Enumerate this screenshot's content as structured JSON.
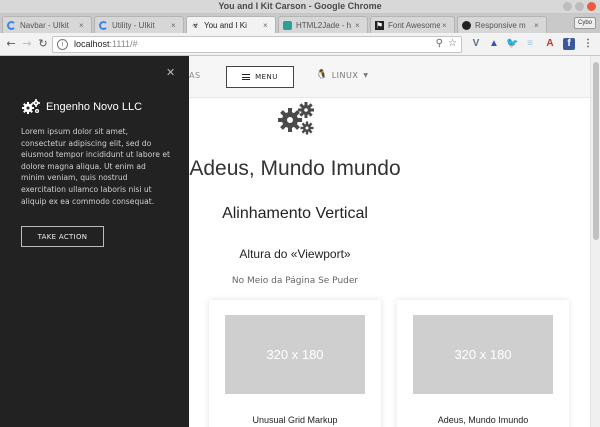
{
  "window": {
    "title": "You and I Kit Carson - Google Chrome"
  },
  "tabs": [
    {
      "label": "Navbar - UIkit",
      "favicon": "spinner-icon"
    },
    {
      "label": "Utility - UIkit",
      "favicon": "spinner-icon"
    },
    {
      "label": "You and I Ki",
      "favicon": "biohazard-icon",
      "active": true
    },
    {
      "label": "HTML2Jade - h",
      "favicon": "html-icon"
    },
    {
      "label": "Font Awesome",
      "favicon": "flag-icon"
    },
    {
      "label": "Responsive m",
      "favicon": "github-icon"
    }
  ],
  "profile_badge": "Cybo",
  "address_bar": {
    "url_host": "localhost",
    "url_rest": ":1111/#"
  },
  "extensions": [
    "V",
    "▲",
    "🐦",
    "≡",
    "A",
    "f"
  ],
  "page": {
    "nav": {
      "partial_item": "AS",
      "menu_label": "MENU",
      "linux_label": "LINUX"
    },
    "heading": "Adeus, Mundo Imundo",
    "subheading": "Alinhamento Vertical",
    "h3": "Altura do «Viewport»",
    "small": "No Meio da Página Se Puder",
    "cards": [
      {
        "placeholder": "320 x 180",
        "title": "Unusual Grid Markup"
      },
      {
        "placeholder": "320 x 180",
        "title": "Adeus, Mundo Imundo"
      }
    ]
  },
  "offcanvas": {
    "brand": "Engenho Novo LLC",
    "text": "Lorem ipsum dolor sit amet, consectetur adipiscing elit, sed do eiusmod tempor incididunt ut labore et dolore magna aliqua. Ut enim ad minim veniam, quis nostrud exercitation ullamco laboris nisi ut aliquip ex ea commodo consequat.",
    "button": "TAKE ACTION"
  }
}
